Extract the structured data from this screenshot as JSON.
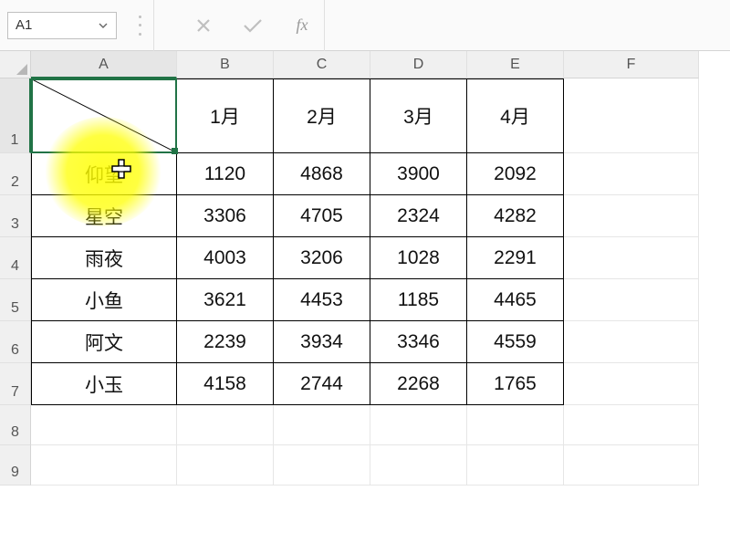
{
  "formula_bar": {
    "cell_ref": "A1",
    "formula_value": "",
    "fx_label": "fx"
  },
  "columns": [
    "A",
    "B",
    "C",
    "D",
    "E",
    "F"
  ],
  "rows": [
    "1",
    "2",
    "3",
    "4",
    "5",
    "6",
    "7",
    "8",
    "9"
  ],
  "active_cell": {
    "col": "A",
    "row": "1"
  },
  "chart_data": {
    "type": "table",
    "column_headers": [
      "",
      "1月",
      "2月",
      "3月",
      "4月"
    ],
    "row_headers": [
      "仰望",
      "星空",
      "雨夜",
      "小鱼",
      "阿文",
      "小玉"
    ],
    "data": [
      [
        1120,
        4868,
        3900,
        2092
      ],
      [
        3306,
        4705,
        2324,
        4282
      ],
      [
        4003,
        3206,
        1028,
        2291
      ],
      [
        3621,
        4453,
        1185,
        4465
      ],
      [
        2239,
        3934,
        3346,
        4559
      ],
      [
        4158,
        2744,
        2268,
        1765
      ]
    ]
  },
  "icons": {
    "dropdown": "chevron-down-icon",
    "cancel": "x-icon",
    "accept": "check-icon",
    "fx": "fx-icon"
  },
  "colors": {
    "selection_border": "#217346",
    "highlight": "#ffff00"
  }
}
